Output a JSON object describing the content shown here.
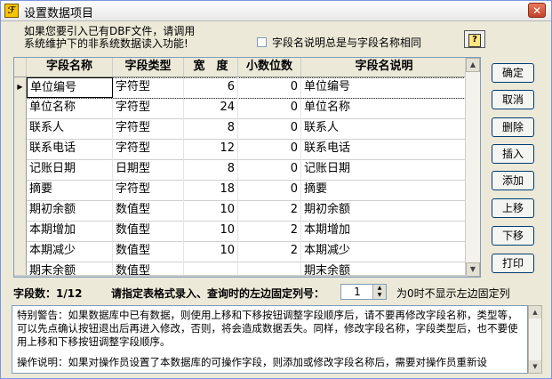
{
  "window": {
    "title": "设置数据项目",
    "close_glyph": "✕"
  },
  "info": {
    "line1": "如果您要引入已有DBF文件，请调用",
    "line2": "系统维护下的非系统数据读入功能!"
  },
  "same_name_checkbox": {
    "label": "字段名说明总是与字段名称相同",
    "checked": false
  },
  "help_button": {
    "label": "?"
  },
  "grid": {
    "columns": [
      "字段名称",
      "字段类型",
      "宽　度",
      "小数位数",
      "字段名说明"
    ],
    "rows": [
      {
        "name": "单位编号",
        "type": "字符型",
        "width": "6",
        "decimals": "0",
        "desc": "单位编号"
      },
      {
        "name": "单位名称",
        "type": "字符型",
        "width": "24",
        "decimals": "0",
        "desc": "单位名称"
      },
      {
        "name": "联系人",
        "type": "字符型",
        "width": "8",
        "decimals": "0",
        "desc": "联系人"
      },
      {
        "name": "联系电话",
        "type": "字符型",
        "width": "12",
        "decimals": "0",
        "desc": "联系电话"
      },
      {
        "name": "记账日期",
        "type": "日期型",
        "width": "8",
        "decimals": "0",
        "desc": "记账日期"
      },
      {
        "name": "摘要",
        "type": "字符型",
        "width": "18",
        "decimals": "0",
        "desc": "摘要"
      },
      {
        "name": "期初余额",
        "type": "数值型",
        "width": "10",
        "decimals": "2",
        "desc": "期初余额"
      },
      {
        "name": "本期增加",
        "type": "数值型",
        "width": "10",
        "decimals": "2",
        "desc": "本期增加"
      },
      {
        "name": "本期减少",
        "type": "数值型",
        "width": "10",
        "decimals": "2",
        "desc": "本期减少"
      },
      {
        "name": "期末余额",
        "type": "数值型",
        "width": "",
        "decimals": "",
        "desc": "期末余额"
      }
    ]
  },
  "buttons": {
    "confirm": "确定",
    "cancel": "取消",
    "delete": "删除",
    "insert": "插入",
    "add": "添加",
    "up": "上移",
    "down": "下移",
    "print": "打印"
  },
  "status": {
    "field_count": "字段数：1/12",
    "fix_label": "请指定表格式录入、查询时的左边固定列号：",
    "fix_value": "1",
    "fix_note": "为0时不显示左边固定列"
  },
  "notes": {
    "warning": "特别警告：如果数据库中已有数据，则使用上移和下移按钮调整字段顺序后，请不要再修改字段名称，类型等，可以先点确认按钮退出后再进入修改，否则，将会造成数据丢失。同样，修改字段名称，字段类型后，也不要使用上移和下移按钮调整字段顺序。",
    "instruction": "操作说明：如果对操作员设置了本数据库的可操作字段，则添加或修改字段名称后，需要对操作员重新设"
  }
}
